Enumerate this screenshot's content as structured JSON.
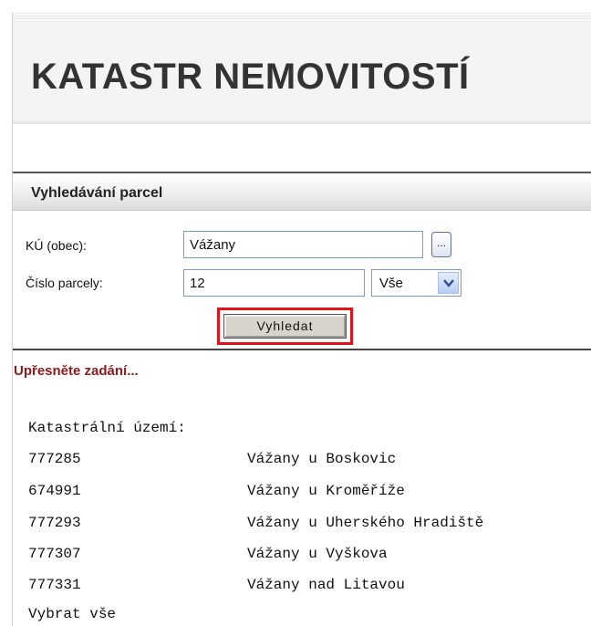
{
  "header": {
    "title": "KATASTR NEMOVITOSTÍ"
  },
  "section": {
    "title": "Vyhledávání parcel"
  },
  "form": {
    "ku_label": "KÚ (obec):",
    "ku_value": "Vážany",
    "browse_label": "...",
    "parcel_label": "Číslo parcely:",
    "parcel_value": "12",
    "type_selected": "Vše",
    "search_label": "Vyhledat"
  },
  "results": {
    "warning": "Upřesněte zadání...",
    "heading": "Katastrální území:",
    "rows": [
      {
        "code": "777285",
        "name": "Vážany u Boskovic"
      },
      {
        "code": "674991",
        "name": "Vážany u Kroměříže"
      },
      {
        "code": "777293",
        "name": "Vážany u Uherského Hradiště"
      },
      {
        "code": "777307",
        "name": "Vážany u Vyškova"
      },
      {
        "code": "777331",
        "name": "Vážany nad Litavou"
      }
    ],
    "select_all": "Vybrat vše"
  },
  "colors": {
    "highlight": "#e0141a",
    "warning": "#8b1a1a",
    "title": "#333333"
  }
}
